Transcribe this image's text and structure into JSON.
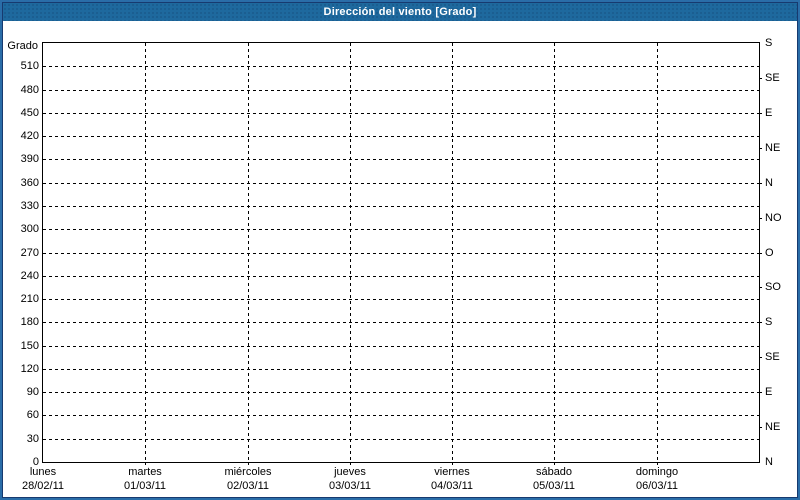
{
  "window": {
    "title": "Dirección del viento [Grado]"
  },
  "colors": {
    "titlebar_bg": "#1e699e",
    "titlebar_text": "#ffffff",
    "outer_border": "#2a6da8",
    "inner_border": "#173a6f",
    "plot_border": "#000000",
    "grid": "#000000",
    "background": "#ffffff",
    "text": "#000000"
  },
  "chart_data": {
    "type": "line",
    "title": "Dirección del viento [Grado]",
    "ylabel_left": "Grado",
    "ylim": [
      0,
      540
    ],
    "y_ticks": [
      0,
      30,
      60,
      90,
      120,
      150,
      180,
      210,
      240,
      270,
      300,
      330,
      360,
      390,
      420,
      450,
      480,
      510
    ],
    "right_axis": [
      {
        "value": 540,
        "label": "S"
      },
      {
        "value": 495,
        "label": "SE"
      },
      {
        "value": 450,
        "label": "E"
      },
      {
        "value": 405,
        "label": "NE"
      },
      {
        "value": 360,
        "label": "N"
      },
      {
        "value": 315,
        "label": "NO"
      },
      {
        "value": 270,
        "label": "O"
      },
      {
        "value": 225,
        "label": "SO"
      },
      {
        "value": 180,
        "label": "S"
      },
      {
        "value": 135,
        "label": "SE"
      },
      {
        "value": 90,
        "label": "E"
      },
      {
        "value": 45,
        "label": "NE"
      },
      {
        "value": 0,
        "label": "N"
      }
    ],
    "x_categories": [
      {
        "day": "lunes",
        "date": "28/02/11"
      },
      {
        "day": "martes",
        "date": "01/03/11"
      },
      {
        "day": "miércoles",
        "date": "02/03/11"
      },
      {
        "day": "jueves",
        "date": "03/03/11"
      },
      {
        "day": "viernes",
        "date": "04/03/11"
      },
      {
        "day": "sábado",
        "date": "05/03/11"
      },
      {
        "day": "domingo",
        "date": "06/03/11"
      }
    ],
    "x_intervals": 7,
    "grid": "dashed",
    "legend": "none",
    "series": []
  }
}
